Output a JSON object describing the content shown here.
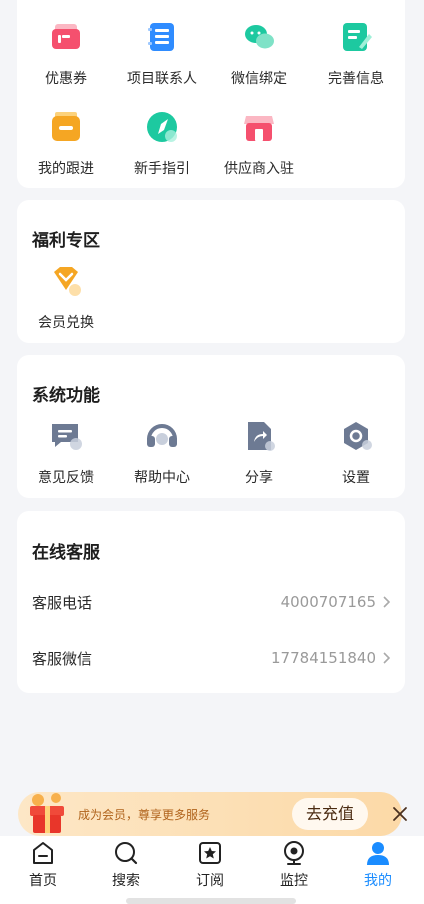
{
  "tools": {
    "items": [
      {
        "label": "优惠券",
        "icon": "coupon-icon",
        "color": "#f5506e"
      },
      {
        "label": "项目联系人",
        "icon": "contact-book-icon",
        "color": "#2f8cff"
      },
      {
        "label": "微信绑定",
        "icon": "wechat-icon",
        "color": "#1dc9a0"
      },
      {
        "label": "完善信息",
        "icon": "edit-info-icon",
        "color": "#1dc9a0"
      },
      {
        "label": "我的跟进",
        "icon": "follow-up-icon",
        "color": "#f5a623"
      },
      {
        "label": "新手指引",
        "icon": "compass-icon",
        "color": "#1dc9a0"
      },
      {
        "label": "供应商入驻",
        "icon": "shop-icon",
        "color": "#f5506e"
      }
    ]
  },
  "welfare": {
    "title": "福利专区",
    "items": [
      {
        "label": "会员兑换",
        "icon": "diamond-icon",
        "color": "#f5a623"
      }
    ]
  },
  "system": {
    "title": "系统功能",
    "items": [
      {
        "label": "意见反馈",
        "icon": "feedback-icon"
      },
      {
        "label": "帮助中心",
        "icon": "headset-icon"
      },
      {
        "label": "分享",
        "icon": "share-icon"
      },
      {
        "label": "设置",
        "icon": "settings-icon"
      }
    ]
  },
  "service": {
    "title": "在线客服",
    "phone_label": "客服电话",
    "phone_value": "4000707165",
    "wechat_label": "客服微信",
    "wechat_value": "17784151840"
  },
  "promo": {
    "text": "成为会员，尊享更多服务",
    "button": "去充值"
  },
  "tabbar": {
    "items": [
      {
        "label": "首页",
        "icon": "home-icon"
      },
      {
        "label": "搜索",
        "icon": "search-icon"
      },
      {
        "label": "订阅",
        "icon": "subscribe-icon"
      },
      {
        "label": "监控",
        "icon": "monitor-icon"
      },
      {
        "label": "我的",
        "icon": "profile-icon"
      }
    ],
    "active_color": "#1a8cff"
  }
}
